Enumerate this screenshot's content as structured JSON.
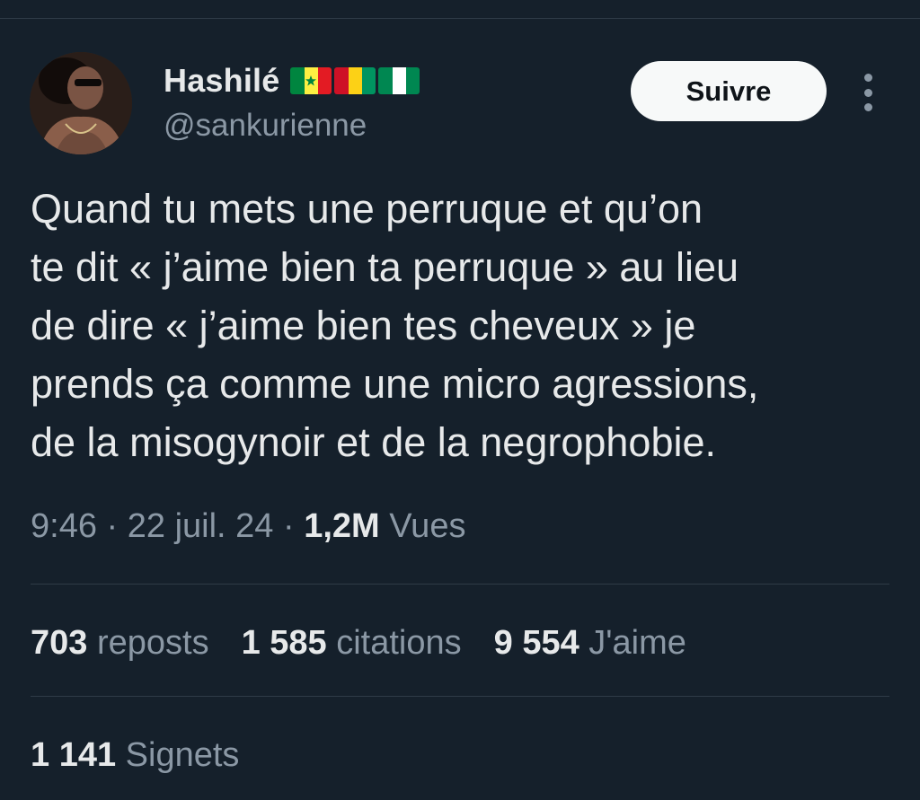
{
  "colors": {
    "background": "#15202b",
    "text_primary": "#e7e9ea",
    "text_secondary": "#8b98a5",
    "divider": "#2f3b47",
    "follow_bg": "#f7f9f9"
  },
  "author": {
    "display_name": "Hashilé",
    "handle": "@sankurienne",
    "flags": [
      "senegal-flag",
      "guinea-flag",
      "nigeria-flag"
    ]
  },
  "follow_label": "Suivre",
  "tweet": {
    "lines": [
      "Quand tu mets une perruque et qu’on",
      "te dit « j’aime bien ta perruque » au lieu",
      "de dire « j’aime bien tes cheveux » je",
      "prends ça comme une micro agressions,",
      "de la misogynoir et de la negrophobie."
    ]
  },
  "meta": {
    "time": "9:46",
    "sep1": " · ",
    "date": "22 juil. 24",
    "sep2": " · ",
    "views_count": "1,2M",
    "views_label": " Vues"
  },
  "stats": {
    "reposts": {
      "count": "703",
      "label": " reposts"
    },
    "quotes": {
      "count": "1 585",
      "label": " citations"
    },
    "likes": {
      "count": "9 554",
      "label": " J'aime"
    }
  },
  "bookmarks": {
    "count": "1 141",
    "label": " Signets"
  }
}
